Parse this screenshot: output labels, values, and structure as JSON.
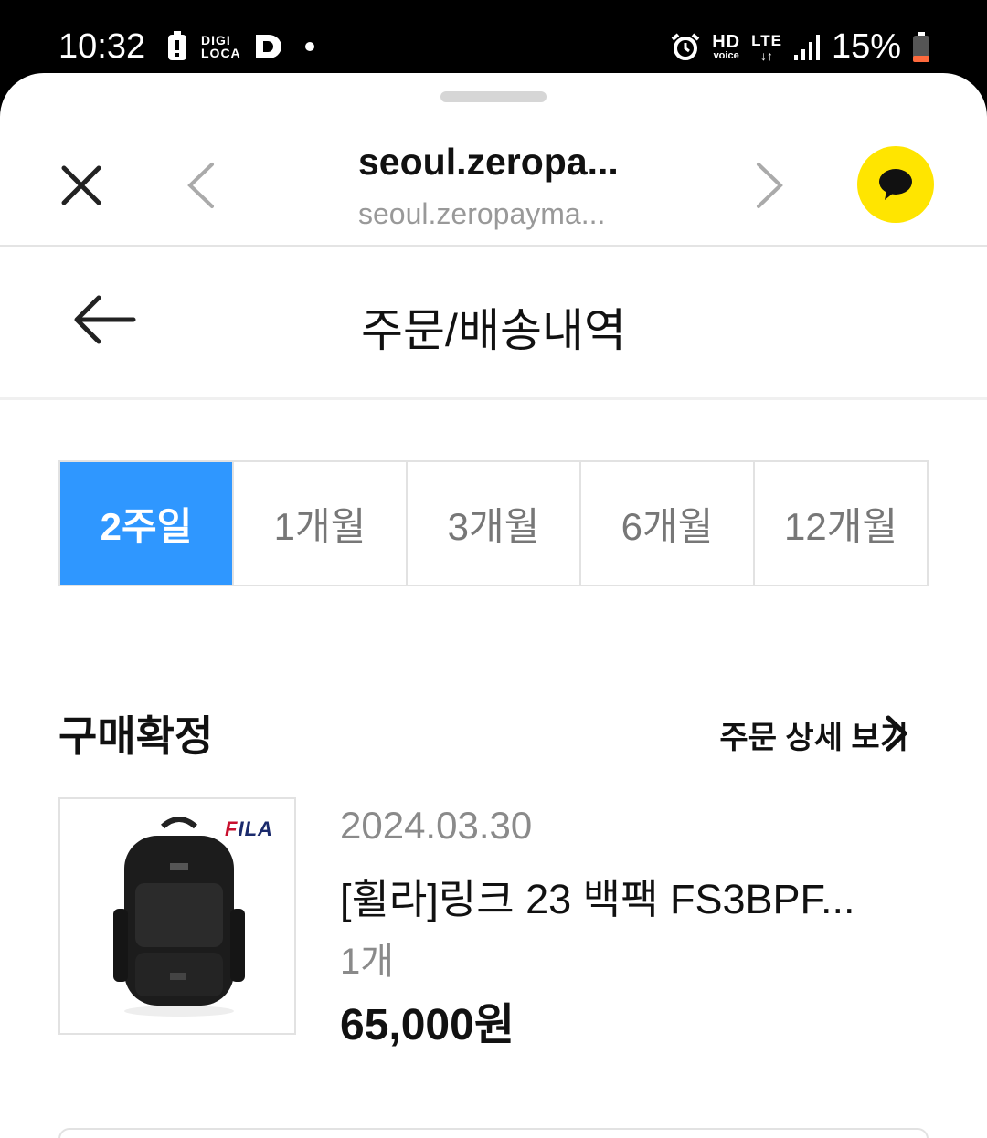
{
  "status_bar": {
    "time": "10:32",
    "left_icons": [
      "battery-alert-icon",
      "digiloca-icon",
      "d-app-icon",
      "dot-icon"
    ],
    "digiloca_top": "DIGI",
    "digiloca_bottom": "LOCA",
    "hd_label": "HD",
    "voice_label": "voice",
    "lte_label": "LTE",
    "battery": "15%"
  },
  "browser": {
    "title": "seoul.zeropa...",
    "url": "seoul.zeropayma..."
  },
  "page": {
    "title": "주문/배송내역"
  },
  "tabs": [
    {
      "label": "2주일",
      "active": true
    },
    {
      "label": "1개월",
      "active": false
    },
    {
      "label": "3개월",
      "active": false
    },
    {
      "label": "6개월",
      "active": false
    },
    {
      "label": "12개월",
      "active": false
    }
  ],
  "order": {
    "status": "구매확정",
    "detail_link": "주문 상세 보기",
    "date": "2024.03.30",
    "product_name": "[휠라]링크 23 백팩 FS3BPF...",
    "quantity": "1개",
    "price": "65,000원",
    "brand_logo": "FILA"
  },
  "colors": {
    "active_tab": "#2f97ff",
    "kakao_yellow": "#ffe500"
  }
}
